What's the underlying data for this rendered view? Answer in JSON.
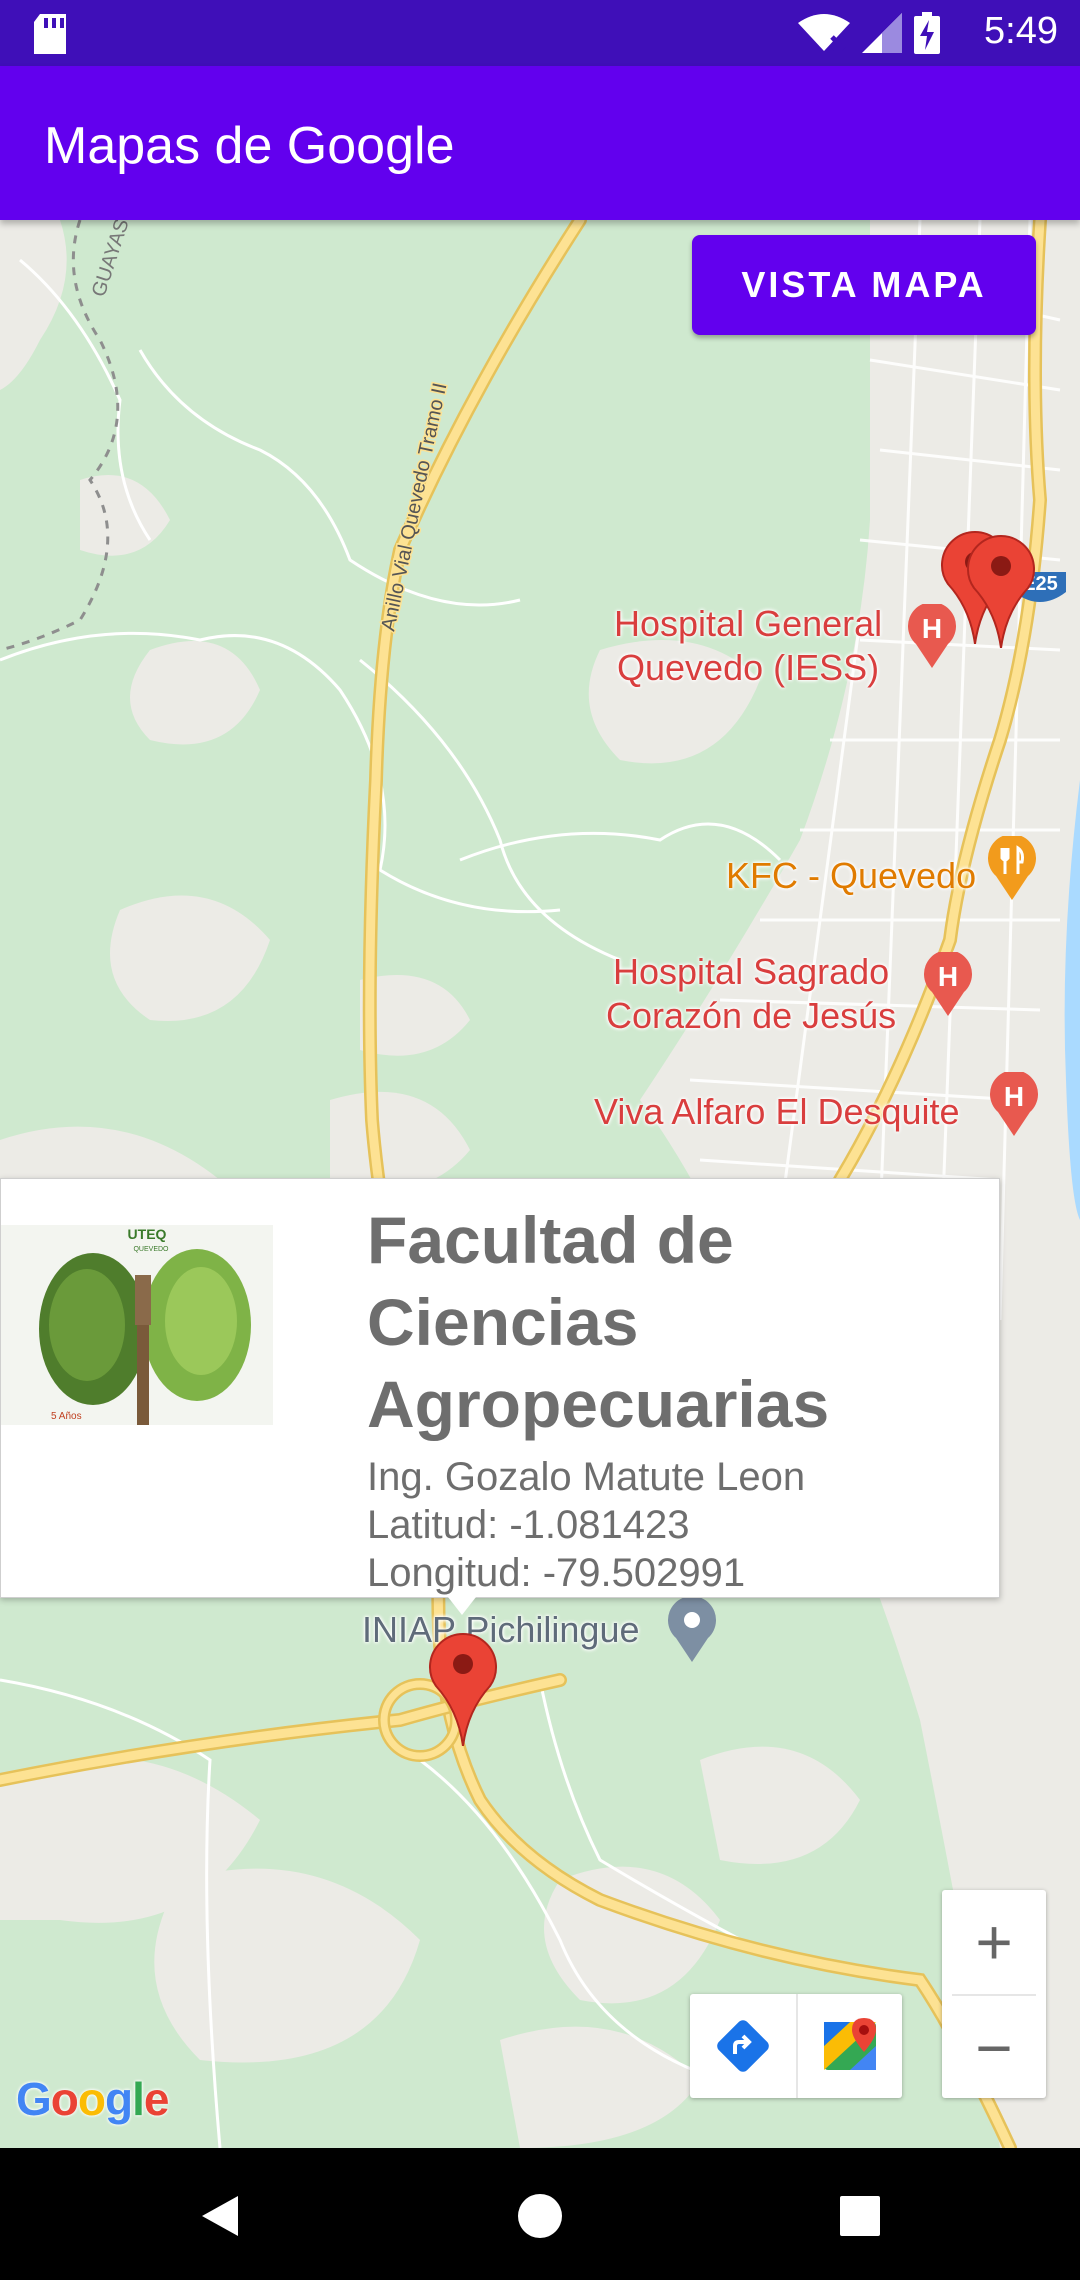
{
  "status_bar": {
    "time": "5:49",
    "icons": [
      "sd-card-icon",
      "wifi-x-icon",
      "signal-icon",
      "battery-charging-icon"
    ]
  },
  "app_bar": {
    "title": "Mapas de Google"
  },
  "map": {
    "toggle_button_label": "VISTA MAPA",
    "highway_badge": "E25",
    "road_labels": {
      "anillo": "Anillo Vial Quevedo Tramo II",
      "guayas": "GUAYAS"
    },
    "places": [
      {
        "kind": "hospital",
        "lines": [
          "Hospital General",
          "Quevedo (IESS)"
        ]
      },
      {
        "kind": "food",
        "lines": [
          "KFC - Quevedo"
        ]
      },
      {
        "kind": "hospital",
        "lines": [
          "Hospital Sagrado",
          "Corazón de Jesús"
        ]
      },
      {
        "kind": "hospital",
        "lines": [
          "Viva Alfaro El Desquite"
        ]
      },
      {
        "kind": "poi",
        "lines": [
          "INIAP Pichilingue"
        ]
      }
    ],
    "google_logo": "Google",
    "zoom_in_label": "+",
    "zoom_out_label": "−"
  },
  "info_window": {
    "title_lines": [
      "Facultad de",
      "Ciencias",
      "Agropecuarias"
    ],
    "person": "Ing. Gozalo Matute Leon",
    "latitude": "Latitud: -1.081423",
    "longitude": "Longitud: -79.502991",
    "thumbnail_text": "UTEQ",
    "thumbnail_sub": "QUEVEDO",
    "thumbnail_corner": "5 Años"
  },
  "colors": {
    "status_bar": "#3f0fb8",
    "app_bar": "#6200ee",
    "marker": "#ea4335",
    "hospital": "#d93e3e",
    "food": "#e07b00"
  }
}
